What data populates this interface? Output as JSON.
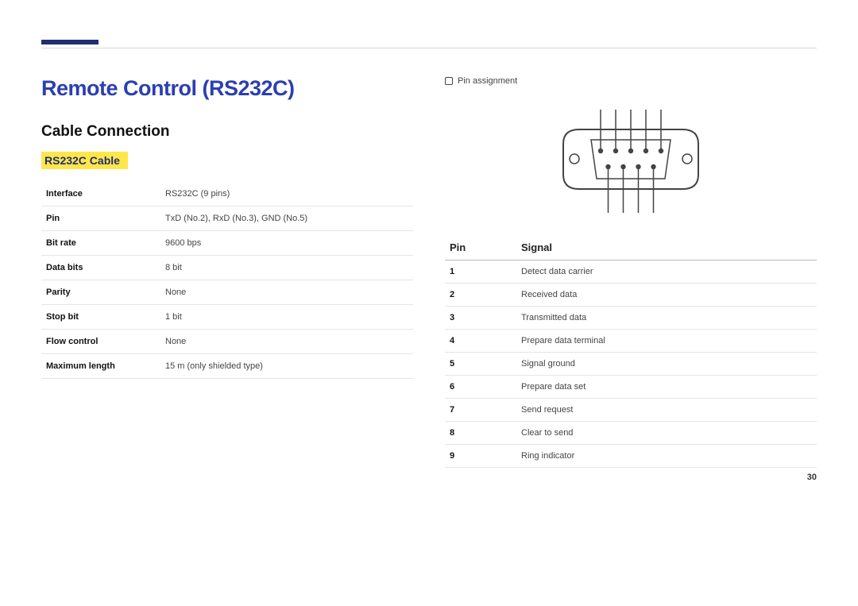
{
  "header": {
    "title": "Remote Control (RS232C)",
    "section": "Cable Connection",
    "subsection": "RS232C Cable"
  },
  "spec": {
    "rows": [
      {
        "label": "Interface",
        "value": "RS232C (9 pins)"
      },
      {
        "label": "Pin",
        "value": "TxD (No.2), RxD (No.3), GND (No.5)"
      },
      {
        "label": "Bit rate",
        "value": "9600 bps"
      },
      {
        "label": "Data bits",
        "value": "8 bit"
      },
      {
        "label": "Parity",
        "value": "None"
      },
      {
        "label": "Stop bit",
        "value": "1 bit"
      },
      {
        "label": "Flow control",
        "value": "None"
      },
      {
        "label": "Maximum length",
        "value": "15 m (only shielded type)"
      }
    ]
  },
  "pin_assignment": {
    "label": "Pin assignment",
    "header_pin": "Pin",
    "header_signal": "Signal",
    "rows": [
      {
        "pin": "1",
        "signal": "Detect data carrier"
      },
      {
        "pin": "2",
        "signal": "Received data"
      },
      {
        "pin": "3",
        "signal": "Transmitted data"
      },
      {
        "pin": "4",
        "signal": "Prepare data terminal"
      },
      {
        "pin": "5",
        "signal": "Signal ground"
      },
      {
        "pin": "6",
        "signal": "Prepare data set"
      },
      {
        "pin": "7",
        "signal": "Send request"
      },
      {
        "pin": "8",
        "signal": "Clear to send"
      },
      {
        "pin": "9",
        "signal": "Ring indicator"
      }
    ]
  },
  "page": {
    "number": "30"
  }
}
